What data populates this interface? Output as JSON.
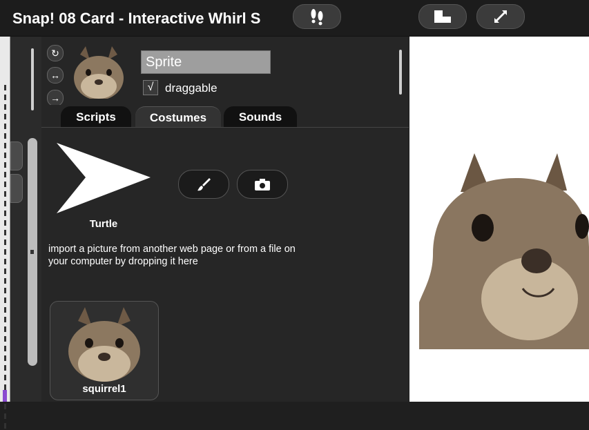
{
  "header": {
    "title": "Snap! 08 Card - Interactive Whirl S",
    "buttons": [
      {
        "name": "steps-button",
        "icon": "footprints-icon"
      },
      {
        "name": "stage-size-button",
        "icon": "stage-size-icon"
      },
      {
        "name": "fullscreen-button",
        "icon": "expand-arrows-icon"
      }
    ]
  },
  "sprite": {
    "name": "Sprite",
    "draggable_label": "draggable",
    "draggable_checked": "√",
    "rotation_buttons": [
      {
        "icon": "rotate-icon",
        "glyph": "↻"
      },
      {
        "icon": "left-right-icon",
        "glyph": "↔"
      },
      {
        "icon": "no-rotate-icon",
        "glyph": "→"
      }
    ]
  },
  "tabs": [
    {
      "label": "Scripts",
      "active": false
    },
    {
      "label": "Costumes",
      "active": true
    },
    {
      "label": "Sounds",
      "active": false
    }
  ],
  "costumes_tab": {
    "turtle_label": "Turtle",
    "paint_tool_icon": "paintbrush-icon",
    "camera_tool_icon": "camera-icon",
    "hint": "import a picture from another web page or from a file on your computer by dropping it here",
    "items": [
      {
        "label": "squirrel1"
      }
    ]
  },
  "colors": {
    "panel": "#262626",
    "topbar": "#1c1c1c",
    "stage": "#ffffff",
    "accent_purple": "#8a4ad0"
  }
}
